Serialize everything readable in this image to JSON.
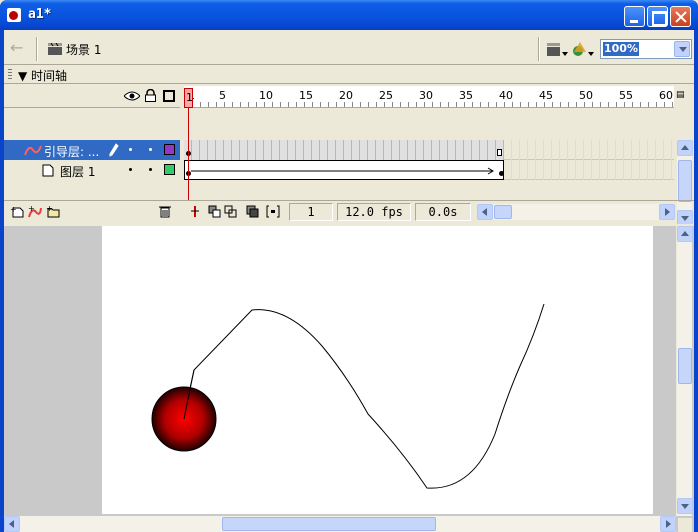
{
  "window": {
    "title": "a1*"
  },
  "toolbar": {
    "scene_label": "场景 1",
    "zoom": "100%"
  },
  "timeline": {
    "title": "时间轴",
    "ruler_numbers": [
      "1",
      "5",
      "10",
      "15",
      "20",
      "25",
      "30",
      "35",
      "40",
      "45",
      "50",
      "55",
      "60"
    ],
    "layers": [
      {
        "name": "引导层: ...",
        "color": "#9933cc",
        "selected": true
      },
      {
        "name": "图层 1",
        "color": "#33cc66",
        "selected": false
      }
    ],
    "current_frame": "1",
    "fps": "12.0 fps",
    "elapsed": "0.0s"
  },
  "colors": {
    "accent": "#316ac5",
    "playhead": "#cc0000",
    "ball": "#cc0000"
  }
}
